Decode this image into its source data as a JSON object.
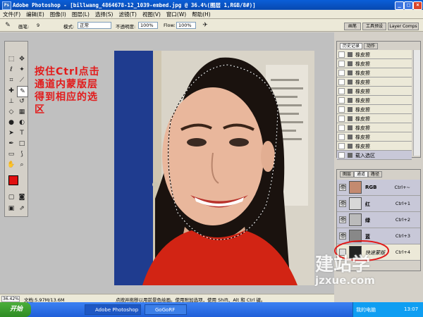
{
  "window": {
    "title": "Adobe Photoshop - [billwang_4864678-12_1039-embed.jpg @ 36.4%(图层 1,RGB/8#)]",
    "app_icon": "Ps"
  },
  "menubar": [
    "文件(F)",
    "编辑(E)",
    "图像(I)",
    "图层(L)",
    "选择(S)",
    "滤镜(T)",
    "视图(V)",
    "窗口(W)",
    "帮助(H)"
  ],
  "options": {
    "brush_label": "画笔:",
    "brush_size": "9",
    "mode_label": "模式:",
    "mode_value": "正常",
    "opacity_label": "不透明度:",
    "opacity_value": "100%",
    "flow_label": "Flow:",
    "flow_value": "100%"
  },
  "palette_well": [
    "画笔",
    "工具预设",
    "Layer Comps"
  ],
  "annotation": [
    "按住Ctrl点击",
    "通道内蒙版层",
    "得到相应的选",
    "区"
  ],
  "history": {
    "tabs": [
      "历史记录",
      "动作"
    ],
    "items": [
      "橡皮擦",
      "橡皮擦",
      "橡皮擦",
      "橡皮擦",
      "橡皮擦",
      "橡皮擦",
      "橡皮擦",
      "橡皮擦",
      "橡皮擦",
      "橡皮擦",
      "橡皮擦"
    ],
    "last": "载入选区"
  },
  "channels": {
    "tabs": [
      "图层",
      "通道",
      "路径"
    ],
    "rows": [
      {
        "name": "RGB",
        "shortcut": "Ctrl+~"
      },
      {
        "name": "红",
        "shortcut": "Ctrl+1"
      },
      {
        "name": "绿",
        "shortcut": "Ctrl+2"
      },
      {
        "name": "蓝",
        "shortcut": "Ctrl+3"
      },
      {
        "name": "快速蒙版",
        "shortcut": "Ctrl+4"
      }
    ]
  },
  "status": {
    "zoom": "36.42%",
    "doc": "文档:5.97M/13.6M",
    "hint": "点按并拖移以用前景色绘画。使用附加选项，使用 Shift、Alt 和 Ctrl 键。"
  },
  "taskbar": {
    "start": "开始",
    "tasks": [
      "Adobe Photoshop",
      "GoGoRF"
    ],
    "tray_text": "我的电脑",
    "clock": "13:07"
  },
  "watermark": [
    "建站学",
    "jzxue.com"
  ],
  "colors": {
    "annotation": "#e21b1b",
    "foreground": "#e01010",
    "title_bar": "#0a5fd8"
  }
}
